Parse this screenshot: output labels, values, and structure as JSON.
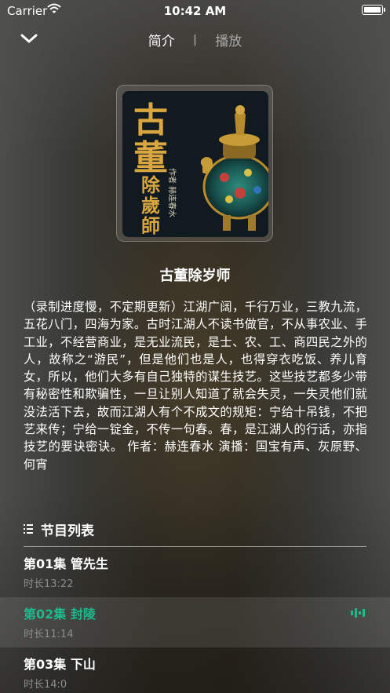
{
  "status_bar": {
    "carrier": "Carrier",
    "time": "10:42 AM"
  },
  "nav": {
    "tab_intro": "简介",
    "divider": "|",
    "tab_play": "播放"
  },
  "cover": {
    "logo_text": "古董除歲師",
    "author_text": "作者 赫连春水"
  },
  "title": "古董除岁师",
  "description": "（录制进度慢，不定期更新）江湖广阔，千行万业，三教九流，五花八门，四海为家。古时江湖人不读书做官，不从事农业、手工业，不经营商业，是无业流民，是士、农、工、商四民之外的人，故称之“游民”，但是他们也是人，也得穿衣吃饭、养儿育女，所以，他们大多有自己独特的谋生技艺。这些技艺都多少带有秘密性和欺骗性，一旦让别人知道了就会失灵，一失灵他们就没法活下去，故而江湖人有个不成文的规矩：宁给十吊钱，不把艺来传；宁给一锭金，不传一句春。春，是江湖人的行话，亦指技艺的要诀密诀。 作者：赫连春水 演播：国宝有声、灰原野、何宵",
  "list": {
    "title": "节目列表",
    "episodes": [
      {
        "title": "第01集 管先生",
        "duration": "时长13:22"
      },
      {
        "title": "第02集 封陵",
        "duration": "时长11:14"
      },
      {
        "title": "第03集 下山",
        "duration": "时长14:0"
      }
    ]
  },
  "colors": {
    "accent": "#1db98d",
    "text": "#ffffff",
    "muted": "#8c8c8a"
  },
  "icons": {
    "back": "chevron-down-icon",
    "list": "list-icon",
    "playing": "audio-wave-icon"
  }
}
